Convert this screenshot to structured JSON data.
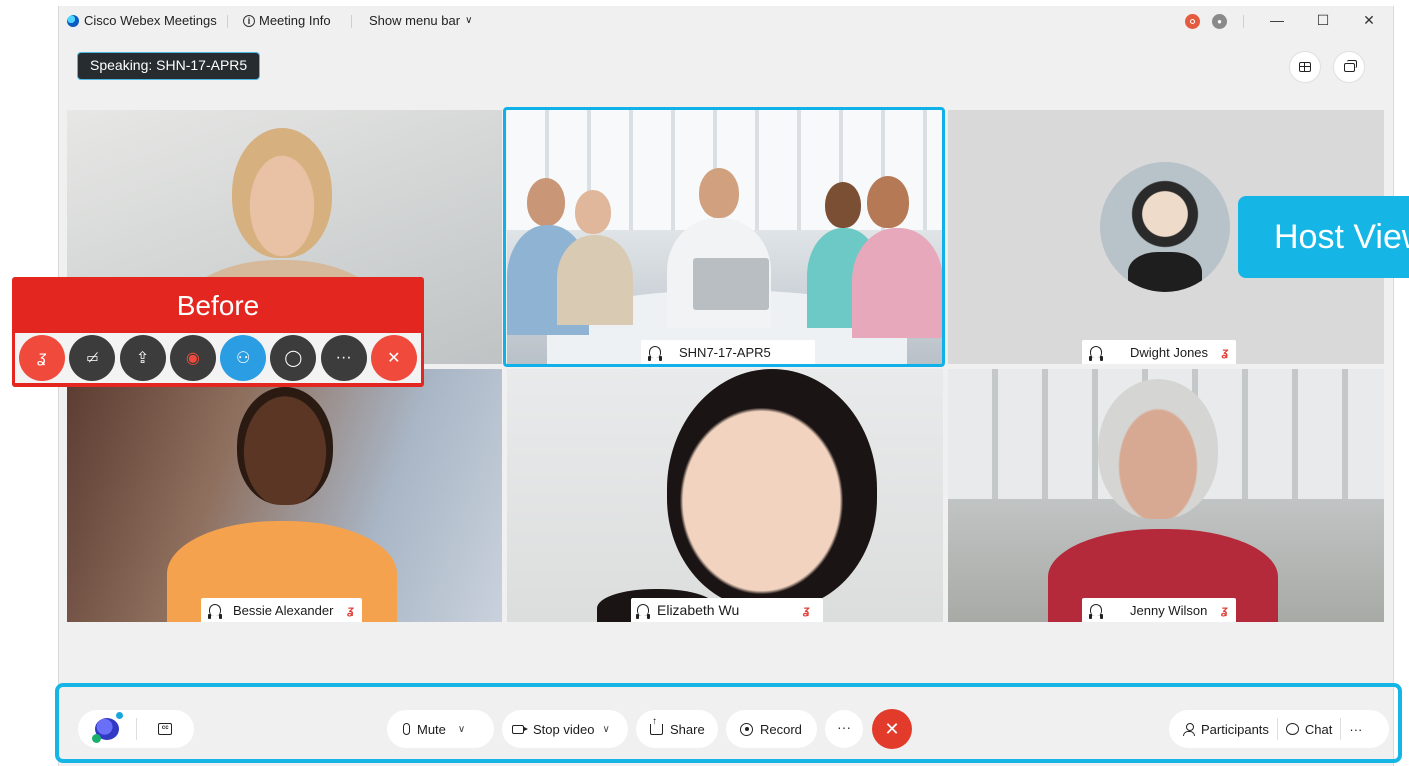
{
  "titlebar": {
    "app_name": "Cisco Webex Meetings",
    "meeting_info": "Meeting Info",
    "show_menu_bar": "Show menu bar",
    "minimize": "—",
    "maximize": "☐",
    "close": "✕"
  },
  "speaking": "Speaking: SHN-17-APR5",
  "tiles": [
    {
      "name": "",
      "muted": false
    },
    {
      "name": "SHN7-17-APR5",
      "muted": false
    },
    {
      "name": "Dwight Jones",
      "muted": true
    },
    {
      "name": "Bessie Alexander",
      "muted": true
    },
    {
      "name": "Elizabeth Wu",
      "muted": true
    },
    {
      "name": "Jenny Wilson",
      "muted": true
    }
  ],
  "callouts": {
    "before": "Before",
    "host_view": "Host View"
  },
  "before_controls": [
    "mute",
    "video",
    "share",
    "record",
    "participants",
    "chat",
    "more",
    "leave"
  ],
  "toolbar": {
    "mute": "Mute",
    "stop_video": "Stop video",
    "share": "Share",
    "record": "Record",
    "more": "···",
    "leave": "✕",
    "participants": "Participants",
    "chat": "Chat",
    "right_more": "···"
  },
  "colors": {
    "accent": "#15b5e6",
    "before_red": "#e3261f",
    "leave_red": "#e23b2c",
    "mute_red": "#e0413a",
    "active_blue": "#2b9de3"
  }
}
